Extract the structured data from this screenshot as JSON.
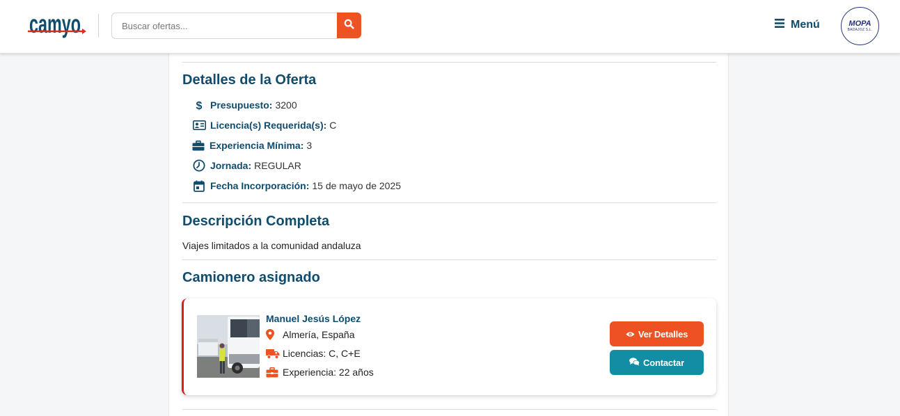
{
  "header": {
    "logo_text": "camyo",
    "search_placeholder": "Buscar ofertas...",
    "menu_label": "Menú",
    "company_avatar": {
      "name": "MOPA",
      "subtitle": "BADAJOZ S.L."
    }
  },
  "offer_details": {
    "title": "Detalles de la Oferta",
    "items": [
      {
        "icon": "dollar-icon",
        "label": "Presupuesto:",
        "value": "3200"
      },
      {
        "icon": "id-card-icon",
        "label": "Licencia(s) Requerida(s):",
        "value": "C"
      },
      {
        "icon": "briefcase-icon",
        "label": "Experiencia Mínima:",
        "value": "3"
      },
      {
        "icon": "clock-icon",
        "label": "Jornada:",
        "value": "REGULAR"
      },
      {
        "icon": "calendar-icon",
        "label": "Fecha Incorporación:",
        "value": "15 de mayo de 2025"
      }
    ]
  },
  "description": {
    "title": "Descripción Completa",
    "text": "Viajes limitados a la comunidad andaluza"
  },
  "assigned_driver": {
    "title": "Camionero asignado",
    "name": "Manuel Jesús López",
    "location": "Almería, España",
    "licenses": "Licencias: C, C+E",
    "experience": "Experiencia: 22 años",
    "view_details_label": "Ver Detalles",
    "contact_label": "Contactar"
  },
  "colors": {
    "primary": "#0f4c6e",
    "accent_orange": "#ee5122",
    "accent_teal": "#128da4",
    "card_border_red": "#d81e1e"
  }
}
